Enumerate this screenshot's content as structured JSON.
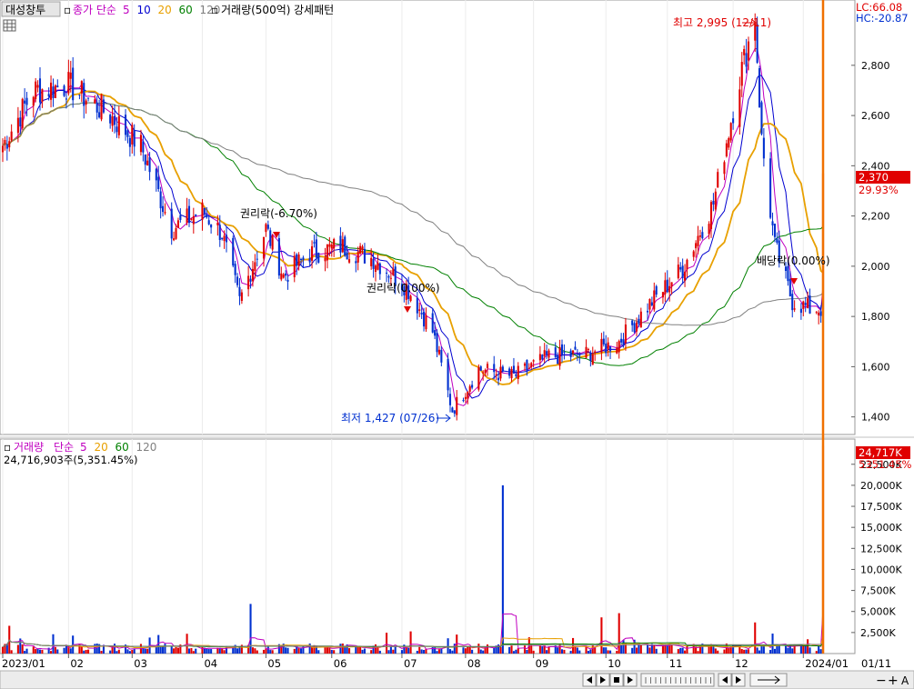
{
  "legend_main": {
    "stock_name": "대성창투",
    "ma_label": "종가 단순",
    "ma_periods": [
      "5",
      "10",
      "20",
      "60",
      "120"
    ],
    "ma_colors": [
      "#c000c0",
      "#0000d0",
      "#e8a000",
      "#008000",
      "#808080"
    ],
    "volume_unit_label": "거래량(500억)",
    "pattern_label": "강세패턴"
  },
  "legend_volume": {
    "label": "거래량",
    "ma_label": "단순",
    "ma_periods": [
      "5",
      "20",
      "60",
      "120"
    ],
    "ma_colors": [
      "#c000c0",
      "#e8a000",
      "#008000",
      "#808080"
    ],
    "value_text": "24,716,903주(5,351.45%)"
  },
  "top_right": {
    "lc": "LC:66.08",
    "hc": "HC:-20.87"
  },
  "current": {
    "price_label": "2,370",
    "change_label": "29.93%",
    "volume_label": "24,717K",
    "volume_change_label": "5351.45%"
  },
  "annotations": {
    "high": "최고 2,995 (12/11)",
    "low": "최저 1,427 (07/26)",
    "ex_rights": "권리락(-6.70%)",
    "ex_rights_2": "권리락(0.00%)",
    "ex_dividend": "배당락(0.00%)"
  },
  "colors": {
    "up": "#e00000",
    "down": "#0030d0",
    "cursor": "#f07000",
    "vol_up": "#e00000",
    "vol_down": "#0030d0"
  },
  "toolbar": {
    "btn_minus": "−",
    "btn_plus": "+",
    "btn_reset": "A"
  },
  "chart_data": [
    {
      "type": "candlestick",
      "title": "대성창투",
      "period": "2023/01 – 2024/01, daily",
      "y_ticks": [
        "1,400",
        "1,600",
        "1,800",
        "2,000",
        "2,200",
        "2,400",
        "2,600",
        "2,800"
      ],
      "ylim": [
        1330,
        3060
      ],
      "x_ticks": [
        "2023/01",
        "02",
        "03",
        "04",
        "05",
        "06",
        "07",
        "08",
        "09",
        "10",
        "11",
        "12",
        "2024/01",
        "01/11"
      ],
      "anchor_points": [
        {
          "date": "2023/01/02",
          "close": 2480
        },
        {
          "date": "2023/01/16",
          "close": 2700
        },
        {
          "date": "2023/02/01",
          "close": 2720
        },
        {
          "date": "2023/02/20",
          "close": 2600
        },
        {
          "date": "2023/03/06",
          "close": 2480
        },
        {
          "date": "2023/03/20",
          "close": 2150
        },
        {
          "date": "2023/04/03",
          "close": 2220
        },
        {
          "date": "2023/04/12",
          "close": 2130
        },
        {
          "date": "2023/04/20",
          "close": 1860
        },
        {
          "date": "2023/05/02",
          "close": 2150
        },
        {
          "date": "2023/05/10",
          "close": 1960
        },
        {
          "date": "2023/05/22",
          "close": 2050
        },
        {
          "date": "2023/06/05",
          "close": 2080
        },
        {
          "date": "2023/06/20",
          "close": 2030
        },
        {
          "date": "2023/07/05",
          "close": 1920
        },
        {
          "date": "2023/07/17",
          "close": 1740
        },
        {
          "date": "2023/07/26",
          "close": 1427
        },
        {
          "date": "2023/08/07",
          "close": 1590
        },
        {
          "date": "2023/08/23",
          "close": 1560
        },
        {
          "date": "2023/09/08",
          "close": 1640
        },
        {
          "date": "2023/09/25",
          "close": 1650
        },
        {
          "date": "2023/10/10",
          "close": 1700
        },
        {
          "date": "2023/10/25",
          "close": 1860
        },
        {
          "date": "2023/11/08",
          "close": 1990
        },
        {
          "date": "2023/11/22",
          "close": 2250
        },
        {
          "date": "2023/12/04",
          "close": 2750
        },
        {
          "date": "2023/12/11",
          "close": 2995
        },
        {
          "date": "2023/12/14",
          "close": 2500
        },
        {
          "date": "2023/12/20",
          "close": 2080
        },
        {
          "date": "2023/12/28",
          "close": 1860
        },
        {
          "date": "2024/01/05",
          "close": 1830
        },
        {
          "date": "2024/01/10",
          "close": 1830
        },
        {
          "date": "2024/01/11",
          "close": 2370
        }
      ],
      "ma_approx": [
        {
          "name": "120",
          "values": [
            2770,
            2420,
            2130,
            1940,
            1830,
            1890
          ]
        },
        {
          "name": "60",
          "values": [
            2760,
            2700,
            2440,
            2100,
            1860,
            1660,
            1820,
            2140
          ]
        },
        {
          "name": "20",
          "values": [
            2700,
            2560,
            2180,
            2060,
            1650,
            1620,
            1750,
            2440,
            2040
          ]
        }
      ]
    },
    {
      "type": "bar",
      "title": "거래량",
      "y_ticks": [
        "2,500K",
        "5,000K",
        "7,500K",
        "10,000K",
        "12,500K",
        "15,000K",
        "17,500K",
        "20,000K",
        "22,500K"
      ],
      "ylim": [
        0,
        25500
      ],
      "units": "K shares",
      "notable_values": [
        {
          "date": "2023/01/05",
          "value": 3300
        },
        {
          "date": "2023/04/25",
          "value": 5900
        },
        {
          "date": "2023/08/18",
          "value": 20000
        },
        {
          "date": "2023/10/02",
          "value": 4300
        },
        {
          "date": "2023/10/10",
          "value": 4800
        },
        {
          "date": "2023/12/11",
          "value": 3700
        },
        {
          "date": "2024/01/11",
          "value": 24717
        }
      ]
    }
  ]
}
